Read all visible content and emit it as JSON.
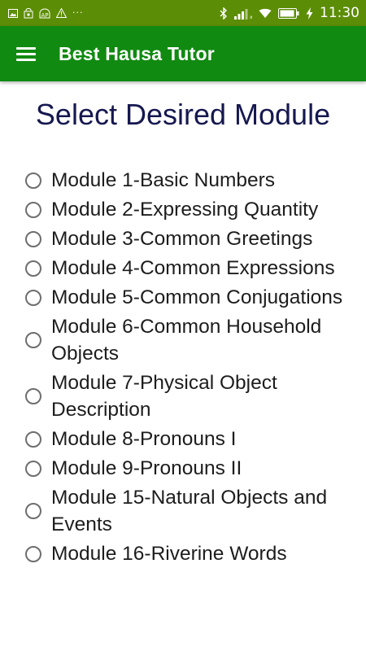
{
  "status_bar": {
    "left_icons": [
      "image-icon",
      "cart-lock-icon",
      "ap-icon",
      "warning-icon"
    ],
    "overflow": "···",
    "right_icons": [
      "bluetooth-icon",
      "signal-icon",
      "wifi-icon",
      "battery-icon",
      "charging-icon"
    ],
    "time": "11:30"
  },
  "app_bar": {
    "menu_icon": "hamburger-icon",
    "title": "Best Hausa Tutor",
    "color": "#118a12"
  },
  "page": {
    "heading": "Select Desired Module"
  },
  "modules": [
    {
      "label": "Module 1-Basic Numbers"
    },
    {
      "label": "Module 2-Expressing Quantity"
    },
    {
      "label": "Module 3-Common Greetings"
    },
    {
      "label": "Module 4-Common Expressions"
    },
    {
      "label": "Module 5-Common Conjugations"
    },
    {
      "label": "Module 6-Common Household Objects"
    },
    {
      "label": "Module 7-Physical Object Description"
    },
    {
      "label": "Module 8-Pronouns I"
    },
    {
      "label": "Module 9-Pronouns II"
    },
    {
      "label": "Module 15-Natural Objects and Events"
    },
    {
      "label": "Module 16-Riverine Words"
    }
  ]
}
